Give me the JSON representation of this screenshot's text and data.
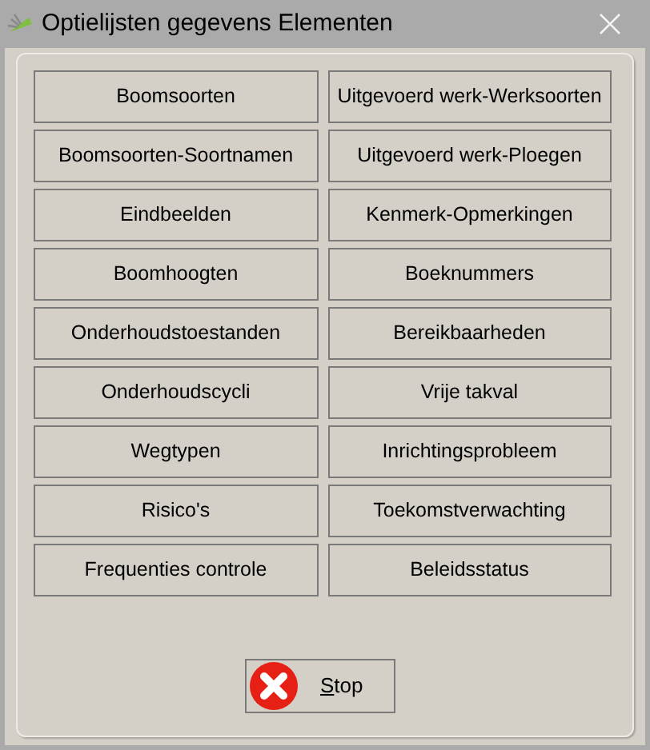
{
  "window": {
    "title": "Optielijsten gegevens Elementen"
  },
  "buttons": [
    {
      "label": "Boomsoorten"
    },
    {
      "label": "Uitgevoerd werk-Werksoorten"
    },
    {
      "label": "Boomsoorten-Soortnamen"
    },
    {
      "label": "Uitgevoerd werk-Ploegen"
    },
    {
      "label": "Eindbeelden"
    },
    {
      "label": "Kenmerk-Opmerkingen"
    },
    {
      "label": "Boomhoogten"
    },
    {
      "label": "Boeknummers"
    },
    {
      "label": "Onderhoudstoestanden"
    },
    {
      "label": "Bereikbaarheden"
    },
    {
      "label": "Onderhoudscycli"
    },
    {
      "label": "Vrije takval"
    },
    {
      "label": "Wegtypen"
    },
    {
      "label": "Inrichtingsprobleem"
    },
    {
      "label": "Risico's"
    },
    {
      "label": "Toekomstverwachting"
    },
    {
      "label": "Frequenties controle"
    },
    {
      "label": "Beleidsstatus"
    }
  ],
  "stop_button": {
    "mnemonic": "S",
    "label_rest": "top"
  }
}
